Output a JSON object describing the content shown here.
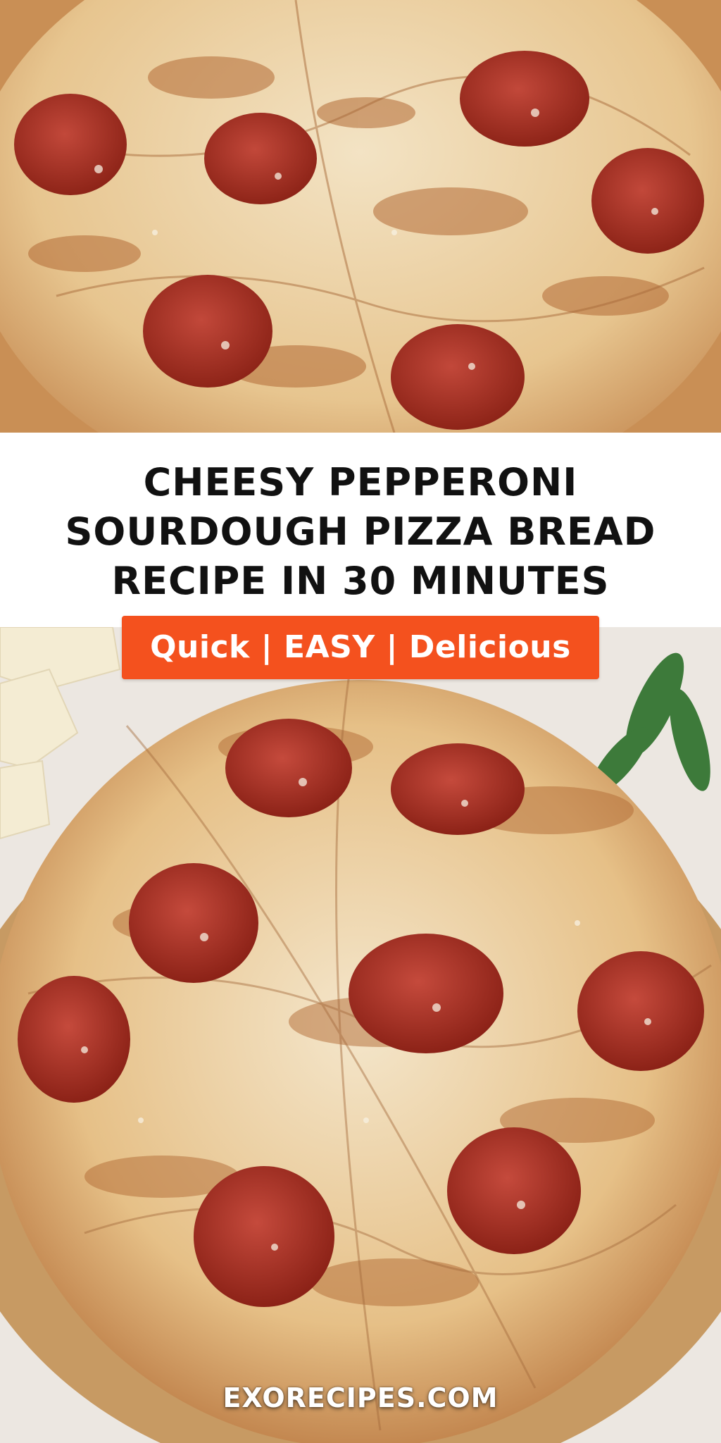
{
  "header": {
    "title_lines": [
      "CHEESY PEPPERONI",
      "SOURDOUGH PIZZA BREAD",
      "RECIPE IN 30 MINUTES"
    ]
  },
  "badge": {
    "text": "Quick | EASY | Delicious"
  },
  "footer": {
    "site": "EXORECIPES.COM"
  },
  "colors": {
    "accent": "#f4511e",
    "band": "#ffffff",
    "title": "#111111"
  }
}
